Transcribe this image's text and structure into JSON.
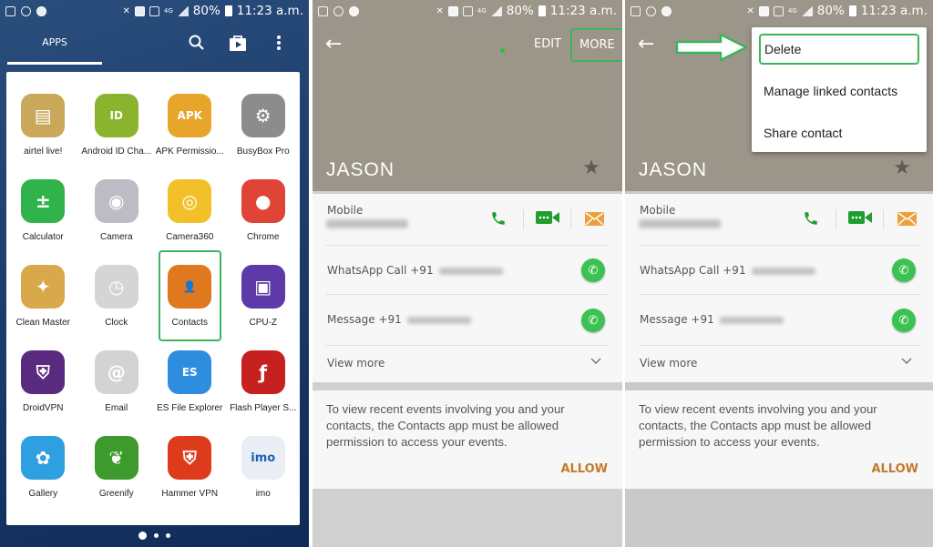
{
  "status_bar": {
    "battery": "80%",
    "time": "11:23 a.m.",
    "sim_label": "1",
    "network": "4G"
  },
  "launcher": {
    "tab_label": "APPS",
    "icons": [
      "search-icon",
      "play-store-icon",
      "more-vert-icon"
    ],
    "apps": [
      {
        "label": "airtel live!",
        "color": "#c9a85a",
        "glyph": "▤"
      },
      {
        "label": "Android ID Cha...",
        "color": "#8bb42e",
        "glyph": "ID"
      },
      {
        "label": "APK Permissio...",
        "color": "#e7a52a",
        "glyph": "APK"
      },
      {
        "label": "BusyBox Pro",
        "color": "#8c8c8c",
        "glyph": "⚙"
      },
      {
        "label": "Calculator",
        "color": "#2fb34a",
        "glyph": "±"
      },
      {
        "label": "Camera",
        "color": "#bcbcc4",
        "glyph": "◉"
      },
      {
        "label": "Camera360",
        "color": "#f2c12a",
        "glyph": "◎"
      },
      {
        "label": "Chrome",
        "color": "#e04436",
        "glyph": "●"
      },
      {
        "label": "Clean Master",
        "color": "#d9a84b",
        "glyph": "✦"
      },
      {
        "label": "Clock",
        "color": "#d5d5d5",
        "glyph": "◷"
      },
      {
        "label": "Contacts",
        "color": "#e0781f",
        "glyph": "👤"
      },
      {
        "label": "CPU-Z",
        "color": "#5d3aa8",
        "glyph": "▣"
      },
      {
        "label": "DroidVPN",
        "color": "#5a2a7e",
        "glyph": "⛨"
      },
      {
        "label": "Email",
        "color": "#d3d3d3",
        "glyph": "@"
      },
      {
        "label": "ES File Explorer",
        "color": "#2f8de0",
        "glyph": "ES"
      },
      {
        "label": "Flash Player S...",
        "color": "#c62020",
        "glyph": "ƒ"
      },
      {
        "label": "Gallery",
        "color": "#2e9fe0",
        "glyph": "✿"
      },
      {
        "label": "Greenify",
        "color": "#3c9b2c",
        "glyph": "❦"
      },
      {
        "label": "Hammer VPN",
        "color": "#de3a1c",
        "glyph": "⛨"
      },
      {
        "label": "imo",
        "color": "#e9eef4",
        "glyph": "imo"
      }
    ],
    "highlighted_app": "Contacts",
    "page_indicator": {
      "pages": 3,
      "current": 1
    }
  },
  "contact": {
    "name": "JASON",
    "edit_label": "EDIT",
    "more_label": "MORE",
    "mobile_label": "Mobile",
    "whatsapp_call_label": "WhatsApp Call +91",
    "message_label": "Message +91",
    "view_more_label": "View more",
    "permission_text": "To view recent events involving you and your contacts, the Contacts app must be allowed permission to access your events.",
    "allow_label": "ALLOW",
    "header_color": "#9c968a",
    "accent_allow": "#c27b2a"
  },
  "more_menu": {
    "items": [
      "Delete",
      "Manage linked contacts",
      "Share contact"
    ],
    "highlighted": "Delete"
  },
  "colors": {
    "highlight": "#3bb55a",
    "call_green": "#1f9d2e",
    "message_orange": "#e9a23b"
  }
}
